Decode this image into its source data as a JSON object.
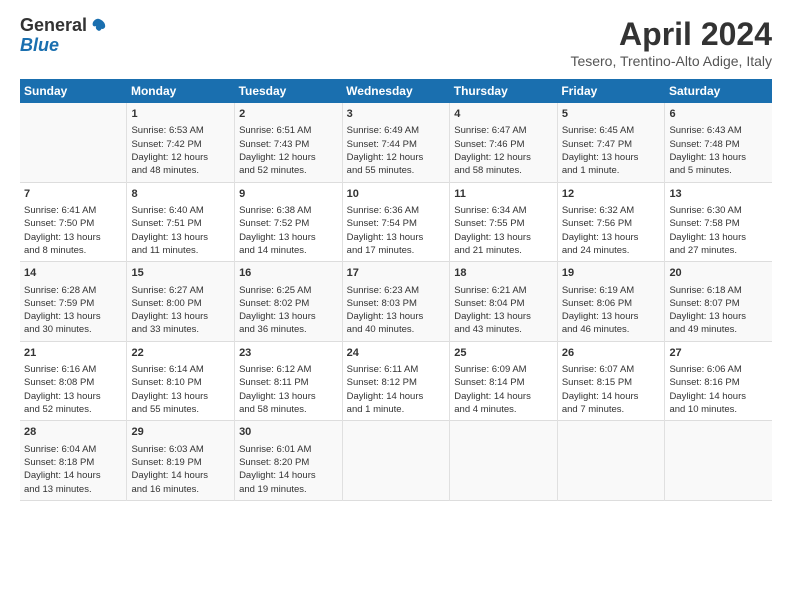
{
  "header": {
    "logo_line1": "General",
    "logo_line2": "Blue",
    "title": "April 2024",
    "subtitle": "Tesero, Trentino-Alto Adige, Italy"
  },
  "calendar": {
    "days_of_week": [
      "Sunday",
      "Monday",
      "Tuesday",
      "Wednesday",
      "Thursday",
      "Friday",
      "Saturday"
    ],
    "weeks": [
      [
        {
          "day": "",
          "content": ""
        },
        {
          "day": "1",
          "content": "Sunrise: 6:53 AM\nSunset: 7:42 PM\nDaylight: 12 hours\nand 48 minutes."
        },
        {
          "day": "2",
          "content": "Sunrise: 6:51 AM\nSunset: 7:43 PM\nDaylight: 12 hours\nand 52 minutes."
        },
        {
          "day": "3",
          "content": "Sunrise: 6:49 AM\nSunset: 7:44 PM\nDaylight: 12 hours\nand 55 minutes."
        },
        {
          "day": "4",
          "content": "Sunrise: 6:47 AM\nSunset: 7:46 PM\nDaylight: 12 hours\nand 58 minutes."
        },
        {
          "day": "5",
          "content": "Sunrise: 6:45 AM\nSunset: 7:47 PM\nDaylight: 13 hours\nand 1 minute."
        },
        {
          "day": "6",
          "content": "Sunrise: 6:43 AM\nSunset: 7:48 PM\nDaylight: 13 hours\nand 5 minutes."
        }
      ],
      [
        {
          "day": "7",
          "content": "Sunrise: 6:41 AM\nSunset: 7:50 PM\nDaylight: 13 hours\nand 8 minutes."
        },
        {
          "day": "8",
          "content": "Sunrise: 6:40 AM\nSunset: 7:51 PM\nDaylight: 13 hours\nand 11 minutes."
        },
        {
          "day": "9",
          "content": "Sunrise: 6:38 AM\nSunset: 7:52 PM\nDaylight: 13 hours\nand 14 minutes."
        },
        {
          "day": "10",
          "content": "Sunrise: 6:36 AM\nSunset: 7:54 PM\nDaylight: 13 hours\nand 17 minutes."
        },
        {
          "day": "11",
          "content": "Sunrise: 6:34 AM\nSunset: 7:55 PM\nDaylight: 13 hours\nand 21 minutes."
        },
        {
          "day": "12",
          "content": "Sunrise: 6:32 AM\nSunset: 7:56 PM\nDaylight: 13 hours\nand 24 minutes."
        },
        {
          "day": "13",
          "content": "Sunrise: 6:30 AM\nSunset: 7:58 PM\nDaylight: 13 hours\nand 27 minutes."
        }
      ],
      [
        {
          "day": "14",
          "content": "Sunrise: 6:28 AM\nSunset: 7:59 PM\nDaylight: 13 hours\nand 30 minutes."
        },
        {
          "day": "15",
          "content": "Sunrise: 6:27 AM\nSunset: 8:00 PM\nDaylight: 13 hours\nand 33 minutes."
        },
        {
          "day": "16",
          "content": "Sunrise: 6:25 AM\nSunset: 8:02 PM\nDaylight: 13 hours\nand 36 minutes."
        },
        {
          "day": "17",
          "content": "Sunrise: 6:23 AM\nSunset: 8:03 PM\nDaylight: 13 hours\nand 40 minutes."
        },
        {
          "day": "18",
          "content": "Sunrise: 6:21 AM\nSunset: 8:04 PM\nDaylight: 13 hours\nand 43 minutes."
        },
        {
          "day": "19",
          "content": "Sunrise: 6:19 AM\nSunset: 8:06 PM\nDaylight: 13 hours\nand 46 minutes."
        },
        {
          "day": "20",
          "content": "Sunrise: 6:18 AM\nSunset: 8:07 PM\nDaylight: 13 hours\nand 49 minutes."
        }
      ],
      [
        {
          "day": "21",
          "content": "Sunrise: 6:16 AM\nSunset: 8:08 PM\nDaylight: 13 hours\nand 52 minutes."
        },
        {
          "day": "22",
          "content": "Sunrise: 6:14 AM\nSunset: 8:10 PM\nDaylight: 13 hours\nand 55 minutes."
        },
        {
          "day": "23",
          "content": "Sunrise: 6:12 AM\nSunset: 8:11 PM\nDaylight: 13 hours\nand 58 minutes."
        },
        {
          "day": "24",
          "content": "Sunrise: 6:11 AM\nSunset: 8:12 PM\nDaylight: 14 hours\nand 1 minute."
        },
        {
          "day": "25",
          "content": "Sunrise: 6:09 AM\nSunset: 8:14 PM\nDaylight: 14 hours\nand 4 minutes."
        },
        {
          "day": "26",
          "content": "Sunrise: 6:07 AM\nSunset: 8:15 PM\nDaylight: 14 hours\nand 7 minutes."
        },
        {
          "day": "27",
          "content": "Sunrise: 6:06 AM\nSunset: 8:16 PM\nDaylight: 14 hours\nand 10 minutes."
        }
      ],
      [
        {
          "day": "28",
          "content": "Sunrise: 6:04 AM\nSunset: 8:18 PM\nDaylight: 14 hours\nand 13 minutes."
        },
        {
          "day": "29",
          "content": "Sunrise: 6:03 AM\nSunset: 8:19 PM\nDaylight: 14 hours\nand 16 minutes."
        },
        {
          "day": "30",
          "content": "Sunrise: 6:01 AM\nSunset: 8:20 PM\nDaylight: 14 hours\nand 19 minutes."
        },
        {
          "day": "",
          "content": ""
        },
        {
          "day": "",
          "content": ""
        },
        {
          "day": "",
          "content": ""
        },
        {
          "day": "",
          "content": ""
        }
      ]
    ]
  }
}
